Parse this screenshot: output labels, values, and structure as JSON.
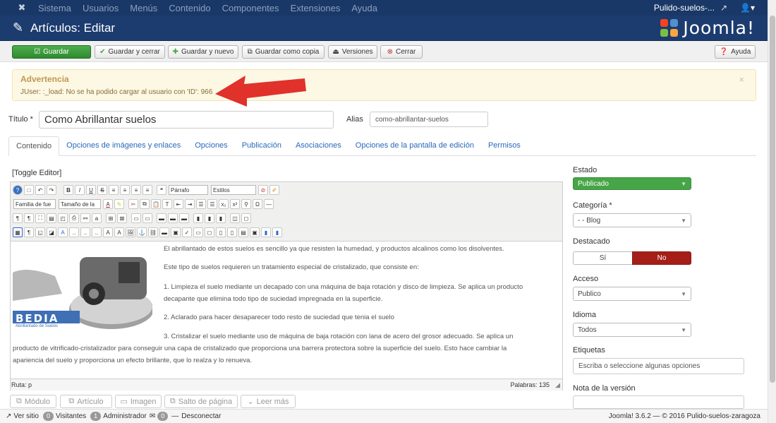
{
  "topnav": {
    "menu": [
      "Sistema",
      "Usuarios",
      "Menús",
      "Contenido",
      "Componentes",
      "Extensiones",
      "Ayuda"
    ],
    "site_name": "Pulido-suelos-...",
    "site_icon": "external-link-icon",
    "user_icon": "user-icon"
  },
  "header": {
    "title": "Artículos: Editar",
    "brand": "Joomla!"
  },
  "toolbar": {
    "save": "Guardar",
    "save_close": "Guardar y cerrar",
    "save_new": "Guardar y nuevo",
    "save_copy": "Guardar como copia",
    "versions": "Versiones",
    "close": "Cerrar",
    "help": "Ayuda"
  },
  "alert": {
    "heading": "Advertencia",
    "message": "JUser: :_load: No se ha podido cargar al usuario con 'ID': 966"
  },
  "form": {
    "title_label": "Título *",
    "title_value": "Como Abrillantar suelos",
    "alias_label": "Alias",
    "alias_value": "como-abrillantar-suelos"
  },
  "tabs": [
    "Contenido",
    "Opciones de imágenes y enlaces",
    "Opciones",
    "Publicación",
    "Asociaciones",
    "Opciones de la pantalla de edición",
    "Permisos"
  ],
  "editor": {
    "toggle": "[Toggle Editor]",
    "format_select": "Párrafo",
    "styles_select": "Estilos",
    "font_family_select": "Familia de fue",
    "font_size_select": "Tamaño de la",
    "image_brand": "BEDIA",
    "image_tagline": "Abrillantado de Suelos",
    "paragraphs": [
      "El abrillantado de estos suelos es sencillo ya que resisten la humedad, y productos alcalinos como los disolventes.",
      "Este tipo de suelos requieren un tratamiento especial de cristalizado, que consiste en:",
      "1. Limpieza el suelo mediante un decapado con una máquina de baja rotación y disco de limpieza. Se aplica un producto",
      "decapante que elimina todo tipo de suciedad impregnada en la superficie.",
      "2.  Aclarado para hacer desaparecer todo resto de suciedad que tenia el suelo",
      "3. Cristalizar el suelo mediante uso de máquina de baja rotación con lana de acero del grosor adecuado. Se aplica un",
      "producto de vitrificado-cristalizador para conseguir una capa de cristalizado que proporciona una barrera protectora sobre la superficie del suelo. Esto hace cambiar la",
      "apariencia del suelo y proporciona un efecto brillante, que lo realza y lo renueva."
    ],
    "path": "Ruta:  p",
    "words": "Palabras: 135"
  },
  "bottom_buttons": [
    "Módulo",
    "Artículo",
    "Imagen",
    "Salto de página",
    "Leer más"
  ],
  "sidebar": {
    "estado_label": "Estado",
    "estado_value": "Publicado",
    "categoria_label": "Categoría *",
    "categoria_value": "- - Blog",
    "destacado_label": "Destacado",
    "si": "Sí",
    "no": "No",
    "acceso_label": "Acceso",
    "acceso_value": "Publico",
    "idioma_label": "Idioma",
    "idioma_value": "Todos",
    "etiquetas_label": "Etiquetas",
    "etiquetas_placeholder": "Escriba o seleccione algunas opciones",
    "nota_label": "Nota de la versión"
  },
  "footer": {
    "view_site": "Ver sitio",
    "visitors_count": "0",
    "visitors": "Visitantes",
    "admin_count": "1",
    "admin": "Administrador",
    "messages_count": "0",
    "logout": "Desconectar",
    "copyright": "Joomla! 3.6.2 — © 2016 Pulido-suelos-zaragoza"
  },
  "colors": {
    "nav": "#1a3867",
    "header": "#1c3c6f",
    "green": "#46a546",
    "danger": "#a51f18",
    "link": "#2a69b8"
  }
}
